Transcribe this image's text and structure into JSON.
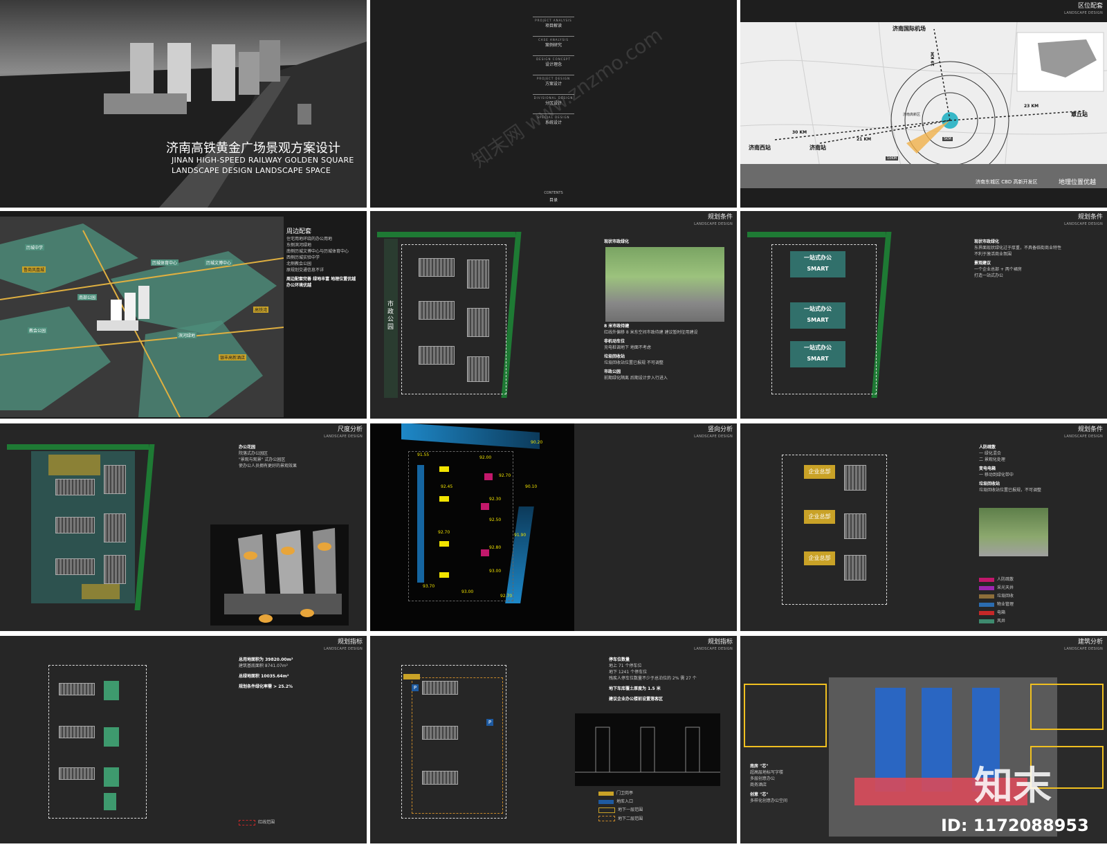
{
  "slides": {
    "s1": {
      "title_cn": "济南高铁黄金广场景观方案设计",
      "title_en_1": "JINAN HIGH-SPEED RAILWAY GOLDEN SQUARE",
      "title_en_2": "LANDSCAPE DESIGN  LANDSCAPE SPACE"
    },
    "s2": {
      "menu": [
        {
          "en": "PROJECT ANALYSIS",
          "cn": "项目解读"
        },
        {
          "en": "CASE ANALYSIS",
          "cn": "案例研究"
        },
        {
          "en": "DESIGN CONCEPT",
          "cn": "设计理念"
        },
        {
          "en": "PROJECT DESIGN",
          "cn": "方案设计"
        },
        {
          "en": "DIVISIONAL DESIGN",
          "cn": "分区设计"
        },
        {
          "en": "SPECIAL DESIGN",
          "cn": "系统设计"
        }
      ],
      "contents_en": "CONTENTS",
      "contents_cn": "目录"
    },
    "s3": {
      "title": "区位配套",
      "subtitle": "LANDSCAPE DESIGN",
      "airport": "济南国际机场",
      "west": "济南西站",
      "station": "济南站",
      "east": "章丘站",
      "newarea": "济南高新区",
      "d30": "30 KM",
      "d21": "21 KM",
      "d23": "23 KM",
      "d19": "19 KM",
      "d5": "5KM",
      "d10": "10KM",
      "bottom_small": "济南东城区  CBD 高新开发区",
      "bottom_big": "地理位置优越"
    },
    "s4": {
      "heading": "周边配套",
      "items": [
        "住宅用地环绕的办公用地",
        "东侧滨河绿地",
        "南侧历城文博中心与历城体育中心",
        "西侧历城实验中学",
        "北侧教会公园",
        "原规划交通信息不详"
      ],
      "bold1": "周边配套完善  绿地丰富  地理位置优越",
      "bold2": "办公环境优越",
      "labels": [
        "历城中学",
        "鲁商凤凰城",
        "历城体育中心",
        "历城文博中心",
        "教会公园",
        "南部公园",
        "滨河绿地",
        "高铁湾",
        "银丰高新酒店"
      ]
    },
    "s5": {
      "title": "规划条件",
      "subtitle": "LANDSCAPE DESIGN",
      "park_label": "市政公园",
      "t1_h": "现状市政绿化",
      "t2_h": "8 米市政待建",
      "t2_b": "红线外偏移 8 米东空间市政待建  建议暂时征用建设",
      "t3_h": "非机动车位",
      "t3_b": "充电桩调地下  地面不考虑",
      "t4_h": "垃圾回收站",
      "t4_b": "垃圾回收站位置已报规  不可调整",
      "t5_h": "市政公园",
      "t5_b": "前期绿化隔离  后期设计步入行进入"
    },
    "s6": {
      "title": "规划条件",
      "subtitle": "LANDSCAPE DESIGN",
      "block1": "一站式办公",
      "block2": "SMART",
      "t1_h": "现状市政绿化",
      "t1_b1": "东界面现状绿化过于厚重，不具备临街商业特性",
      "t1_b2": "不利于激活商业氛围",
      "t2_h": "景观建议",
      "t2_b1": "一个企业总部 + 两个裙房",
      "t2_b2": "打造一站式办公"
    },
    "s7": {
      "title": "尺度分析",
      "subtitle": "LANDSCAPE DESIGN",
      "h": "办公花园",
      "b1": "院落式办公园区",
      "b2": "\"景观与观景\" 式办公园区",
      "b3": "使办公人员拥有更好的景观效果"
    },
    "s8": {
      "title": "竖向分析",
      "subtitle": "LANDSCAPE DESIGN",
      "elev": [
        "90.20",
        "91.55",
        "92.00",
        "92.70",
        "92.45",
        "90.10",
        "92.30",
        "92.50",
        "92.70",
        "91.90",
        "92.80",
        "93.00",
        "93.70",
        "93.00",
        "92.70"
      ]
    },
    "s9": {
      "title": "规划条件",
      "subtitle": "LANDSCAPE DESIGN",
      "hq": "企业总部",
      "t1_h": "人防疏散",
      "t1_b1": "一 绿化混合",
      "t1_b2": "二 景观化处理",
      "t2_h": "变电电箱",
      "t2_b": "一 移动到绿化带中",
      "t3_h": "垃圾回收站",
      "t3_b": "垃圾回收站位置已报规，不可调整",
      "legend": [
        {
          "label": "人防疏散",
          "color": "#c2186b"
        },
        {
          "label": "采光天井",
          "color": "#9c27b0"
        },
        {
          "label": "垃圾回收",
          "color": "#8d6e3a"
        },
        {
          "label": "物业管理",
          "color": "#2b6cb0"
        },
        {
          "label": "电箱",
          "color": "#c62828"
        },
        {
          "label": "风井",
          "color": "#3e8a6e"
        }
      ]
    },
    "s10": {
      "title": "规划指标",
      "subtitle": "LANDSCAPE DESIGN",
      "l1": "总用地面积为 39820.00m²",
      "l1b": "建筑基底面积 8741.07m²",
      "l2": "总绿地面积 10035.64m²",
      "l3": "规划条件绿化率需 > 25.2%",
      "legend": "红线范围"
    },
    "s11": {
      "title": "规划指标",
      "subtitle": "LANDSCAPE DESIGN",
      "h1": "停车位数量",
      "b1": "地上 71 个停车位",
      "b2": "地下 1241 个停车位",
      "b3": "残疾人停车位数量不少于总泊位的 2%  需 27 个",
      "h2": "地下车库覆土厚度为 1.5 米",
      "h3": "建议企业办公楼前设置落客区",
      "legend": [
        "门卫岗亭",
        "地库入口",
        "地下一层范围",
        "地下二层范围"
      ]
    },
    "s12": {
      "title": "建筑分析",
      "subtitle": "LANDSCAPE DESIGN",
      "h1": "南房 \"芯\"",
      "b1a": "超高层地标写字楼",
      "b1b": "多层创意办公",
      "b1c": "商务酒店",
      "h2": "创意 \"芯\"",
      "b2": "多样化创意办公空间",
      "watermark_logo": "知末",
      "id": "ID: 1172088953"
    },
    "watermark": "知末网 www.znzmo.com"
  },
  "colors": {
    "green": "#1e7a34",
    "teal": "#347e78",
    "gold": "#c9a227",
    "blue": "#1e88c8"
  }
}
